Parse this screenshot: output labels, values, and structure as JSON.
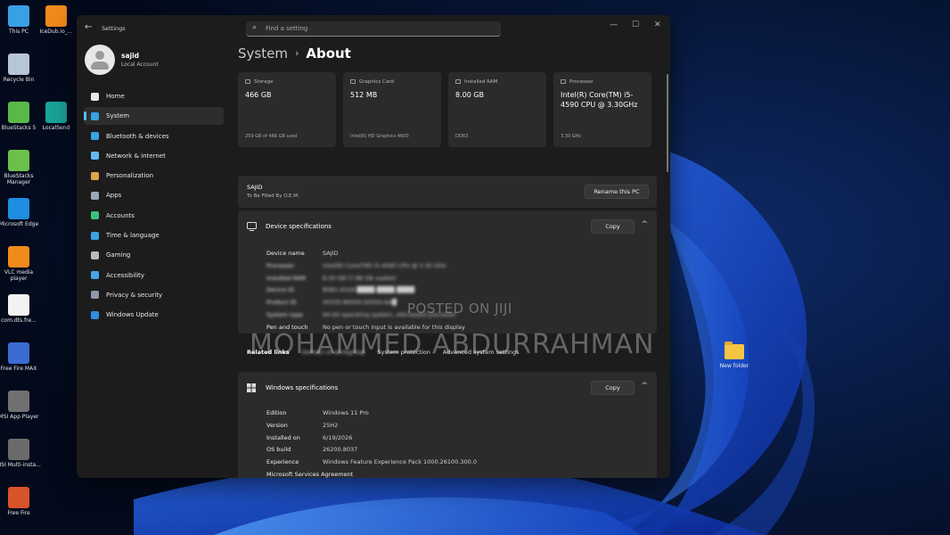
{
  "desktop": {
    "icons": [
      {
        "label": "This PC",
        "icon": "monitor-icon",
        "color": "#3aa0e6"
      },
      {
        "label": "IceDub.io_...",
        "icon": "vlc-cone-icon",
        "color": "#f08a1c"
      },
      {
        "label": "Recycle Bin",
        "icon": "recycle-bin-icon",
        "color": "#b7c6d6"
      },
      {
        "label": "BlueStacks 5",
        "icon": "bluestacks-icon",
        "color": "#58b947"
      },
      {
        "label": "LocalSend",
        "icon": "localsend-icon",
        "color": "#1aa39a"
      },
      {
        "label": "BlueStacks Manager",
        "icon": "bluestacks-manager-icon",
        "color": "#6cc04a"
      },
      {
        "label": "Microsoft Edge",
        "icon": "edge-icon",
        "color": "#1f8de0"
      },
      {
        "label": "VLC media player",
        "icon": "vlc-cone-icon",
        "color": "#f08a1c"
      },
      {
        "label": "com.dts.fre...",
        "icon": "file-icon",
        "color": "#f2f2f2"
      },
      {
        "label": "Free Fire MAX",
        "icon": "free-fire-max-icon",
        "color": "#3b6bd1"
      },
      {
        "label": "MSI App Player",
        "icon": "msi-app-player-icon",
        "color": "#707070"
      },
      {
        "label": "MSI Multi-insta...",
        "icon": "msi-multi-instance-icon",
        "color": "#6b6b6b"
      },
      {
        "label": "Free Fire",
        "icon": "free-fire-icon",
        "color": "#d9532b"
      }
    ],
    "new_folder_label": "New folder"
  },
  "window": {
    "title": "Settings",
    "search_placeholder": "Find a setting",
    "back_glyph": "←",
    "min_glyph": "—",
    "max_glyph": "☐",
    "close_glyph": "✕",
    "search_glyph": "⌕"
  },
  "profile": {
    "name": "sajid",
    "account_type": "Local Account"
  },
  "nav": [
    {
      "label": "Home",
      "icon": "home-icon",
      "color": "#e8e8e8"
    },
    {
      "label": "System",
      "icon": "system-display-icon",
      "color": "#3aa0e6",
      "selected": true
    },
    {
      "label": "Bluetooth & devices",
      "icon": "bluetooth-icon",
      "color": "#3aa0e6"
    },
    {
      "label": "Network & internet",
      "icon": "wifi-icon",
      "color": "#65b8f0"
    },
    {
      "label": "Personalization",
      "icon": "brush-icon",
      "color": "#e0a24a"
    },
    {
      "label": "Apps",
      "icon": "apps-icon",
      "color": "#9aa8b8"
    },
    {
      "label": "Accounts",
      "icon": "person-icon",
      "color": "#3fbf7f"
    },
    {
      "label": "Time & language",
      "icon": "globe-clock-icon",
      "color": "#3aa0e6"
    },
    {
      "label": "Gaming",
      "icon": "gamepad-icon",
      "color": "#bbbbbb"
    },
    {
      "label": "Accessibility",
      "icon": "accessibility-icon",
      "color": "#4aa3e6"
    },
    {
      "label": "Privacy & security",
      "icon": "shield-icon",
      "color": "#8c9aa8"
    },
    {
      "label": "Windows Update",
      "icon": "update-icon",
      "color": "#2f8fe0"
    }
  ],
  "breadcrumb": {
    "parent": "System",
    "separator": "›",
    "current": "About"
  },
  "cards": [
    {
      "label": "Storage",
      "value": "466 GB",
      "sub": "259 GB of 466 GB used"
    },
    {
      "label": "Graphics Card",
      "value": "512 MB",
      "sub": "Intel(R) HD Graphics 4600"
    },
    {
      "label": "Installed RAM",
      "value": "8.00 GB",
      "sub": "DDR3"
    },
    {
      "label": "Processor",
      "value": "Intel(R) Core(TM) i5-4590 CPU @ 3.30GHz",
      "sub": "3.30 GHz"
    }
  ],
  "pc": {
    "name": "SAJID",
    "sub": "To Be Filled By O.E.M.",
    "rename_label": "Rename this PC"
  },
  "device_specs": {
    "title": "Device specifications",
    "copy_label": "Copy",
    "rows": [
      {
        "key": "Device name",
        "value": "SAJID"
      },
      {
        "key": "Processor",
        "value": "Intel(R) Core(TM) i5-4590 CPU @ 3.30 GHz"
      },
      {
        "key": "Installed RAM",
        "value": "8.00 GB (7.88 GB usable)"
      },
      {
        "key": "Device ID",
        "value": "B0B1-9328-████-████-████"
      },
      {
        "key": "Product ID",
        "value": "00330-80000-00000-AA█"
      },
      {
        "key": "System type",
        "value": "64-bit operating system, x64-based processor"
      },
      {
        "key": "Pen and touch",
        "value": "No pen or touch input is available for this display"
      }
    ]
  },
  "related_links": {
    "label": "Related links",
    "links": [
      "Domain or workgroup",
      "System protection",
      "Advanced system settings"
    ]
  },
  "windows_specs": {
    "title": "Windows specifications",
    "copy_label": "Copy",
    "rows": [
      {
        "key": "Edition",
        "value": "Windows 11 Pro"
      },
      {
        "key": "Version",
        "value": "25H2"
      },
      {
        "key": "Installed on",
        "value": "6/19/2026"
      },
      {
        "key": "OS build",
        "value": "26200.8037"
      },
      {
        "key": "Experience",
        "value": "Windows Feature Experience Pack 1000.26100.300.0"
      },
      {
        "key": "Microsoft Services Agreement",
        "value": ""
      }
    ]
  },
  "watermark": {
    "small": "POSTED ON JIJI",
    "large": "MOHAMMED ABDURRAHMAN"
  }
}
